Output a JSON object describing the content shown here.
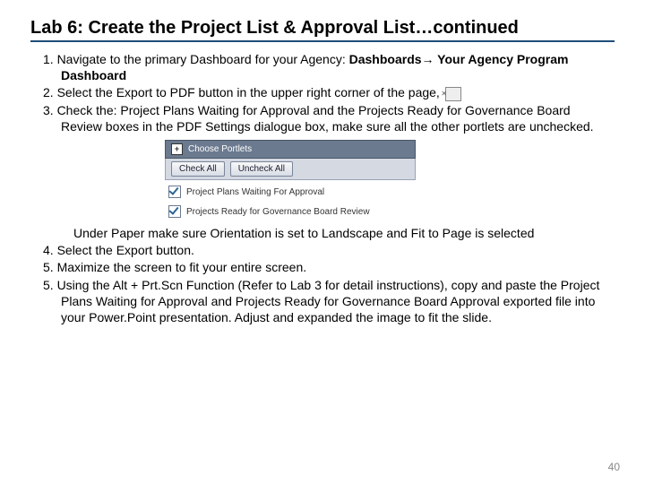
{
  "title": "Lab 6: Create the Project List & Approval List…continued",
  "s1a": "1. Navigate to the primary Dashboard for your Agency: ",
  "s1b": "Dashboards",
  "arrow": "→",
  "s1c": " Your Agency Program Dashboard",
  "s2": "2. Select the Export to PDF button in the upper right corner of the page, ",
  "s3": "3. Check the:  Project Plans Waiting for Approval and the Projects Ready for Governance Board Review boxes in the PDF Settings dialogue box, make sure all the other portlets are unchecked.",
  "portlets": {
    "header": "Choose Portlets",
    "expand": "+",
    "btn1": "Check All",
    "btn2": "Uncheck All",
    "chk1": "Project Plans Waiting For Approval",
    "chk2": "Projects Ready for Governance Board Review"
  },
  "under": "Under Paper make sure Orientation is set to Landscape and Fit to Page is selected",
  "s4": "4. Select the Export button.",
  "s5a": "5.  Maximize the screen to fit your entire screen.",
  "s5b": "5. Using the Alt + Prt.Scn Function (Refer to Lab 3 for detail instructions), copy and paste the Project Plans Waiting for Approval and Projects Ready for Governance Board Approval exported file into your Power.Point presentation. Adjust and expanded the image to fit the slide.",
  "pdf_icon": "✕",
  "page": "40"
}
